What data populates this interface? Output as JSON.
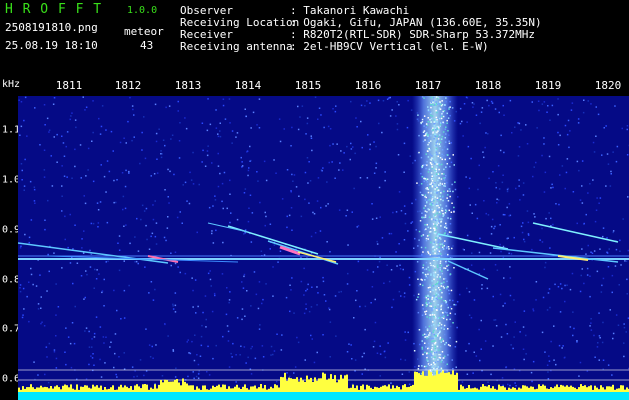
{
  "header": {
    "app_name": "H R O F F T",
    "version": "1.0.0",
    "filename": "2508191810.png",
    "datetime": "25.08.19 18:10",
    "meteor_label": "meteor",
    "meteor_count": "43"
  },
  "info": {
    "rows": [
      {
        "label": "Observer",
        "value": ": Takanori Kawachi"
      },
      {
        "label": "Receiving Location",
        "value": ": Ogaki, Gifu, JAPAN (136.60E, 35.35N)"
      },
      {
        "label": "Receiver",
        "value": ": R820T2(RTL-SDR) SDR-Sharp 53.372MHz"
      },
      {
        "label": "Receiving antenna",
        "value": ": 2el-HB9CV Vertical (el. E-W)"
      }
    ]
  },
  "chart_data": {
    "type": "heatmap",
    "ylabel": "kHz",
    "x_ticks": [
      "1811",
      "1812",
      "1813",
      "1814",
      "1815",
      "1816",
      "1817",
      "1818",
      "1819",
      "1820"
    ],
    "y_ticks": [
      "1.1",
      "1.0",
      "0.9",
      "0.8",
      "0.7",
      "0.6"
    ],
    "xlim": [
      "1810.5",
      "1820.2"
    ],
    "ylim": [
      0.58,
      1.16
    ],
    "colors": {
      "background": "#050a86",
      "noise": "#2a3bd0",
      "signal": "#9ff0ff",
      "strong": "#ff60a0",
      "baseline": "#ffff40",
      "floor": "#00e8ff"
    }
  }
}
